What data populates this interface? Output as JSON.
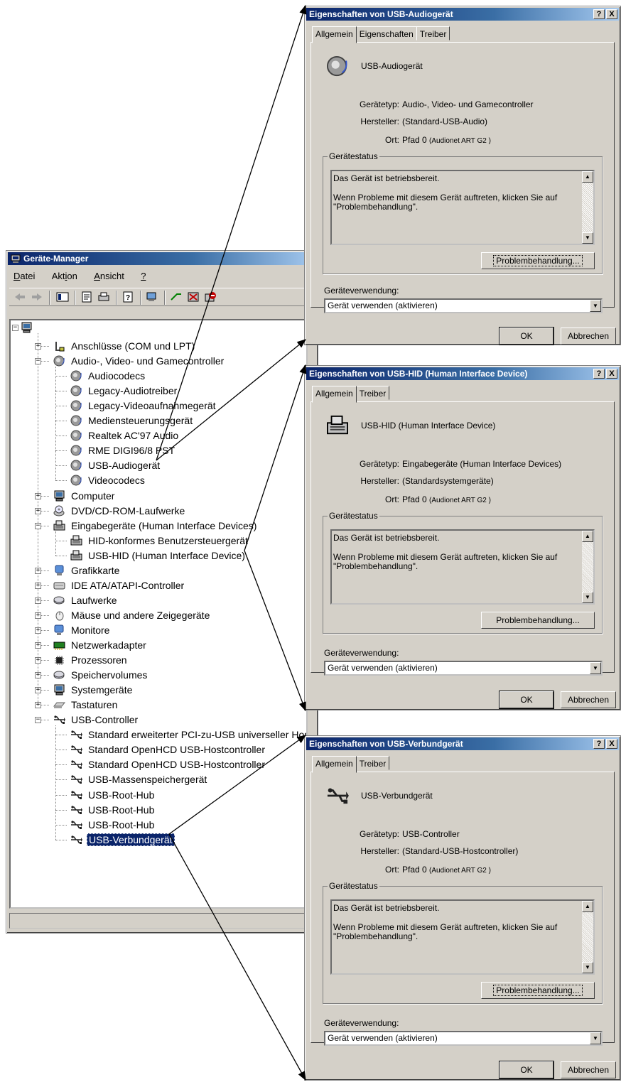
{
  "device_manager": {
    "title": "Geräte-Manager",
    "menu": [
      "Datei",
      "Aktion",
      "Ansicht",
      "?"
    ],
    "tree": [
      {
        "label": "Anschlüsse (COM und LPT)",
        "level": 1,
        "state": "collapsed",
        "icon": "port-icon"
      },
      {
        "label": "Audio-, Video- und Gamecontroller",
        "level": 1,
        "state": "expanded",
        "icon": "speaker-icon"
      },
      {
        "label": "Audiocodecs",
        "level": 2,
        "icon": "speaker-icon"
      },
      {
        "label": "Legacy-Audiotreiber",
        "level": 2,
        "icon": "speaker-icon"
      },
      {
        "label": "Legacy-Videoaufnahmegerät",
        "level": 2,
        "icon": "speaker-icon"
      },
      {
        "label": "Mediensteuerungsgerät",
        "level": 2,
        "icon": "speaker-icon"
      },
      {
        "label": "Realtek AC'97 Audio",
        "level": 2,
        "icon": "speaker-icon"
      },
      {
        "label": "RME DIGI96/8 PST",
        "level": 2,
        "icon": "speaker-icon"
      },
      {
        "label": "USB-Audiogerät",
        "level": 2,
        "icon": "speaker-icon"
      },
      {
        "label": "Videocodecs",
        "level": 2,
        "icon": "speaker-icon"
      },
      {
        "label": "Computer",
        "level": 1,
        "state": "collapsed",
        "icon": "computer-icon"
      },
      {
        "label": "DVD/CD-ROM-Laufwerke",
        "level": 1,
        "state": "collapsed",
        "icon": "cd-drive-icon"
      },
      {
        "label": "Eingabegeräte (Human Interface Devices)",
        "level": 1,
        "state": "expanded",
        "icon": "hid-icon"
      },
      {
        "label": "HID-konformes Benutzersteuergerät",
        "level": 2,
        "icon": "hid-icon"
      },
      {
        "label": "USB-HID (Human Interface Device)",
        "level": 2,
        "icon": "hid-icon"
      },
      {
        "label": "Grafikkarte",
        "level": 1,
        "state": "collapsed",
        "icon": "display-icon"
      },
      {
        "label": "IDE ATA/ATAPI-Controller",
        "level": 1,
        "state": "collapsed",
        "icon": "ide-icon"
      },
      {
        "label": "Laufwerke",
        "level": 1,
        "state": "collapsed",
        "icon": "disk-icon"
      },
      {
        "label": "Mäuse und andere Zeigegeräte",
        "level": 1,
        "state": "collapsed",
        "icon": "mouse-icon"
      },
      {
        "label": "Monitore",
        "level": 1,
        "state": "collapsed",
        "icon": "monitor-icon"
      },
      {
        "label": "Netzwerkadapter",
        "level": 1,
        "state": "collapsed",
        "icon": "network-icon"
      },
      {
        "label": "Prozessoren",
        "level": 1,
        "state": "collapsed",
        "icon": "cpu-icon"
      },
      {
        "label": "Speichervolumes",
        "level": 1,
        "state": "collapsed",
        "icon": "disk-icon"
      },
      {
        "label": "Systemgeräte",
        "level": 1,
        "state": "collapsed",
        "icon": "computer-icon"
      },
      {
        "label": "Tastaturen",
        "level": 1,
        "state": "collapsed",
        "icon": "keyboard-icon"
      },
      {
        "label": "USB-Controller",
        "level": 1,
        "state": "expanded",
        "icon": "usb-icon"
      },
      {
        "label": "Standard erweiterter PCI-zu-USB universeller Hostcontroller",
        "level": 2,
        "icon": "usb-icon"
      },
      {
        "label": "Standard OpenHCD USB-Hostcontroller",
        "level": 2,
        "icon": "usb-icon"
      },
      {
        "label": "Standard OpenHCD USB-Hostcontroller",
        "level": 2,
        "icon": "usb-icon"
      },
      {
        "label": "USB-Massenspeichergerät",
        "level": 2,
        "icon": "usb-icon"
      },
      {
        "label": "USB-Root-Hub",
        "level": 2,
        "icon": "usb-icon"
      },
      {
        "label": "USB-Root-Hub",
        "level": 2,
        "icon": "usb-icon"
      },
      {
        "label": "USB-Root-Hub",
        "level": 2,
        "icon": "usb-icon"
      },
      {
        "label": "USB-Verbundgerät",
        "level": 2,
        "icon": "usb-icon",
        "selected": true
      }
    ]
  },
  "labels": {
    "geraetetyp": "Gerätetyp:",
    "hersteller": "Hersteller:",
    "ort": "Ort:",
    "geraetestatus": "Gerätestatus",
    "status_line1": "Das Gerät ist betriebsbereit.",
    "status_line2": "Wenn Probleme mit diesem Gerät auftreten, klicken Sie auf \"Problembehandlung\".",
    "troubleshoot": "Problembehandlung...",
    "usage": "Geräteverwendung:",
    "usage_value": "Gerät verwenden (aktivieren)",
    "ok": "OK",
    "cancel": "Abbrechen",
    "help": "?",
    "close": "X"
  },
  "dialogs": [
    {
      "title": "Eigenschaften von USB-Audiogerät",
      "tabs": [
        "Allgemein",
        "Eigenschaften",
        "Treiber"
      ],
      "device_name": "USB-Audiogerät",
      "device_icon": "speaker-icon",
      "type": "Audio-, Video- und Gamecontroller",
      "manufacturer": "(Standard-USB-Audio)",
      "location": "Pfad 0",
      "location_detail": "(Audionet ART G2  )"
    },
    {
      "title": "Eigenschaften von USB-HID (Human Interface Device)",
      "tabs": [
        "Allgemein",
        "Treiber"
      ],
      "device_name": "USB-HID (Human Interface Device)",
      "device_icon": "hid-icon",
      "type": "Eingabegeräte (Human Interface Devices)",
      "manufacturer": "(Standardsystemgeräte)",
      "location": "Pfad 0",
      "location_detail": "(Audionet ART G2  )"
    },
    {
      "title": "Eigenschaften von USB-Verbundgerät",
      "tabs": [
        "Allgemein",
        "Treiber"
      ],
      "device_name": "USB-Verbundgerät",
      "device_icon": "usb-icon",
      "type": "USB-Controller",
      "manufacturer": "(Standard-USB-Hostcontroller)",
      "location": "Pfad 0",
      "location_detail": "(Audionet ART G2  )"
    }
  ]
}
